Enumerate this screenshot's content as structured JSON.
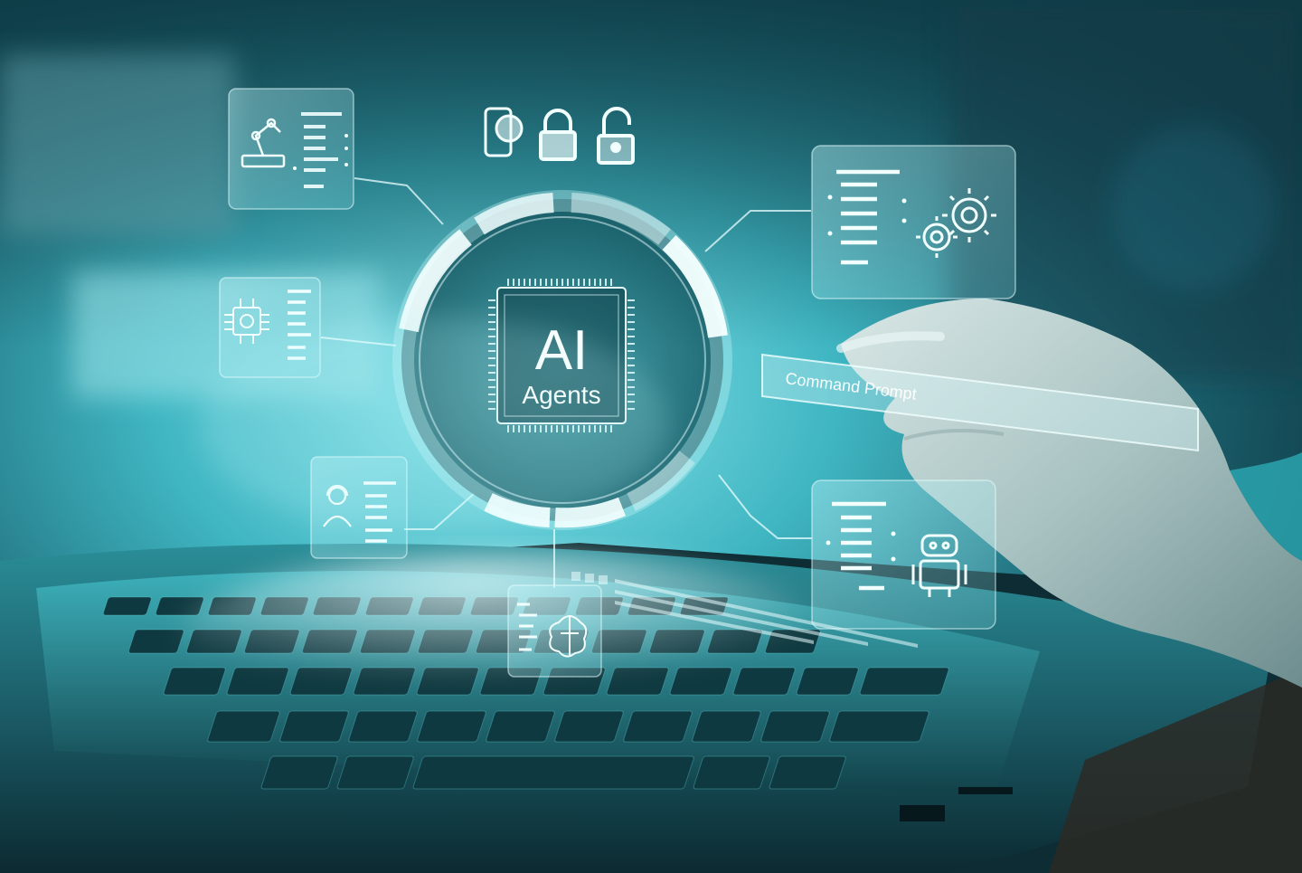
{
  "hub": {
    "title": "AI",
    "subtitle": "Agents"
  },
  "command_prompt": {
    "text": "Command Prompt"
  },
  "icons": {
    "top": [
      "phone-icon",
      "lock-closed-icon",
      "lock-open-icon"
    ],
    "cards": [
      "robot-arm-icon",
      "chip-icon",
      "user-headset-icon",
      "brain-icon",
      "gears-icon",
      "robot-icon"
    ]
  },
  "colors": {
    "accent": "#7ee8ef",
    "glow": "#4fd3df",
    "background_dark": "#071c22",
    "holo_white": "#e8fdff"
  }
}
